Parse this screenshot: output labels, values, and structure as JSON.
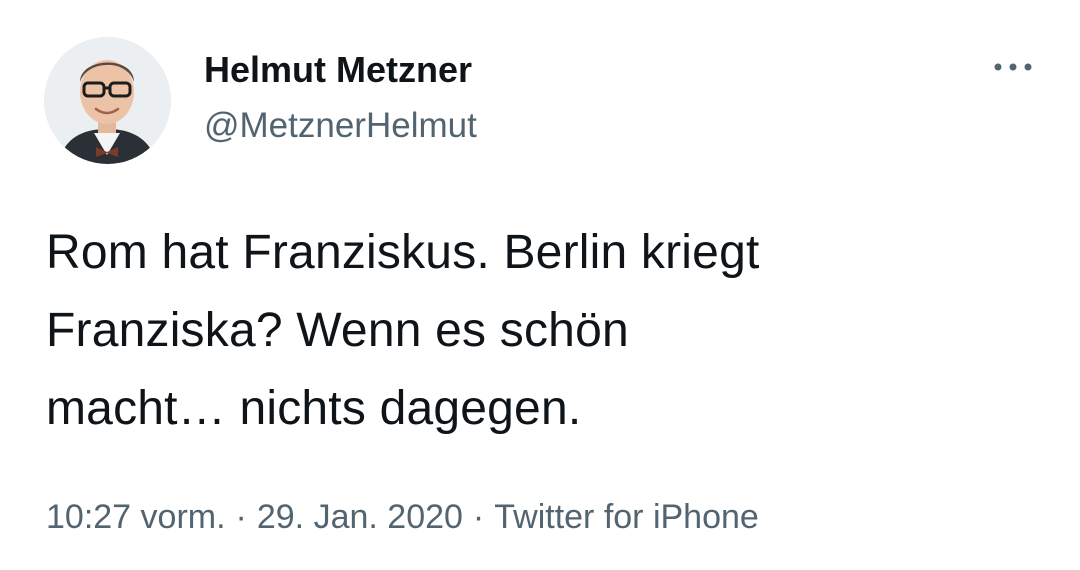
{
  "author": {
    "display_name": "Helmut Metzner",
    "handle": "@MetznerHelmut"
  },
  "tweet": {
    "lines": [
      "Rom hat Franziskus. Berlin kriegt",
      "Franziska? Wenn es schön",
      "macht… nichts dagegen."
    ]
  },
  "meta": {
    "time": "10:27 vorm.",
    "separator": "·",
    "date": "29. Jan. 2020",
    "source": "Twitter for iPhone"
  },
  "icons": {
    "more": "more-horizontal-icon"
  },
  "colors": {
    "text_primary": "#0f1419",
    "text_secondary": "#536471"
  }
}
